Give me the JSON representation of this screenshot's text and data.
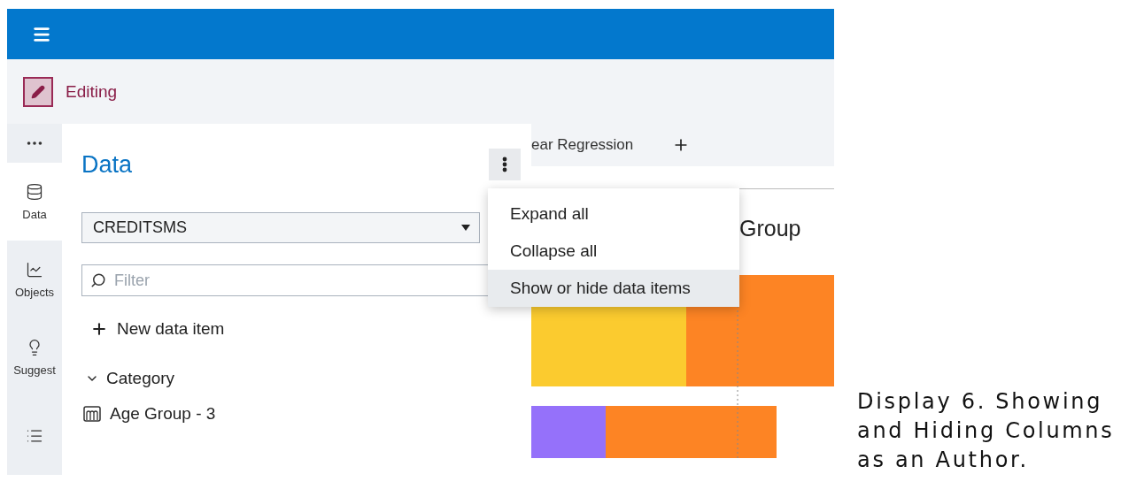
{
  "mode": {
    "label": "Editing"
  },
  "rail": [
    {
      "label": "Data",
      "selected": true
    },
    {
      "label": "Objects",
      "selected": false
    },
    {
      "label": "Suggest",
      "selected": false
    }
  ],
  "panel": {
    "title": "Data",
    "source": "CREDITSMS",
    "filter": {
      "placeholder": "Filter"
    },
    "new_item": "New data item",
    "groups": [
      {
        "label": "Category",
        "expanded": true,
        "children": [
          {
            "label": "Age Group - 3"
          }
        ]
      }
    ]
  },
  "tab": {
    "label": "ear Regression"
  },
  "chart_title": "Group",
  "menu": [
    {
      "label": "Expand all",
      "selected": false
    },
    {
      "label": "Collapse all",
      "selected": false
    },
    {
      "label": "Show or hide data items",
      "selected": true
    }
  ],
  "caption": "Display 6. Showing and Hiding Columns as an Author."
}
